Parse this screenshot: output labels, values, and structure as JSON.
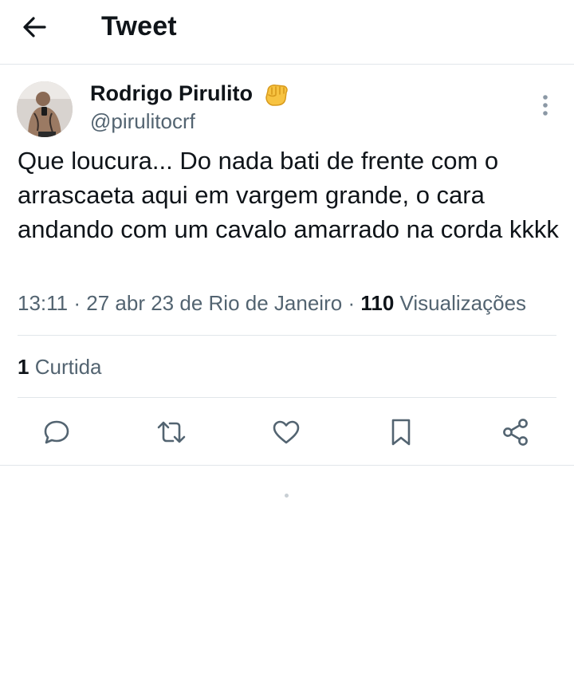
{
  "header": {
    "title": "Tweet",
    "back_icon": "arrow-left-icon"
  },
  "tweet": {
    "author": {
      "name": "Rodrigo Pirulito",
      "emoji": "👊",
      "handle": "@pirulitocrf"
    },
    "text": "Que loucura... Do nada bati de frente com o arrascaeta aqui em vargem grande, o cara andando com um cavalo amarrado na corda kkkk",
    "time": "13:11",
    "date": "27 abr 23",
    "location": "de Rio de Janeiro",
    "separator": "·",
    "views_count": "110",
    "views_label": "Visualizações",
    "likes_count": "1",
    "likes_label": "Curtida"
  },
  "actions": [
    {
      "name": "reply",
      "icon": "reply-icon"
    },
    {
      "name": "retweet",
      "icon": "retweet-icon"
    },
    {
      "name": "like",
      "icon": "heart-icon"
    },
    {
      "name": "bookmark",
      "icon": "bookmark-icon"
    },
    {
      "name": "share",
      "icon": "share-icon"
    }
  ],
  "colors": {
    "text_primary": "#0f1419",
    "text_secondary": "#536471",
    "divider": "#e1e6ea",
    "icon": "#536471"
  }
}
